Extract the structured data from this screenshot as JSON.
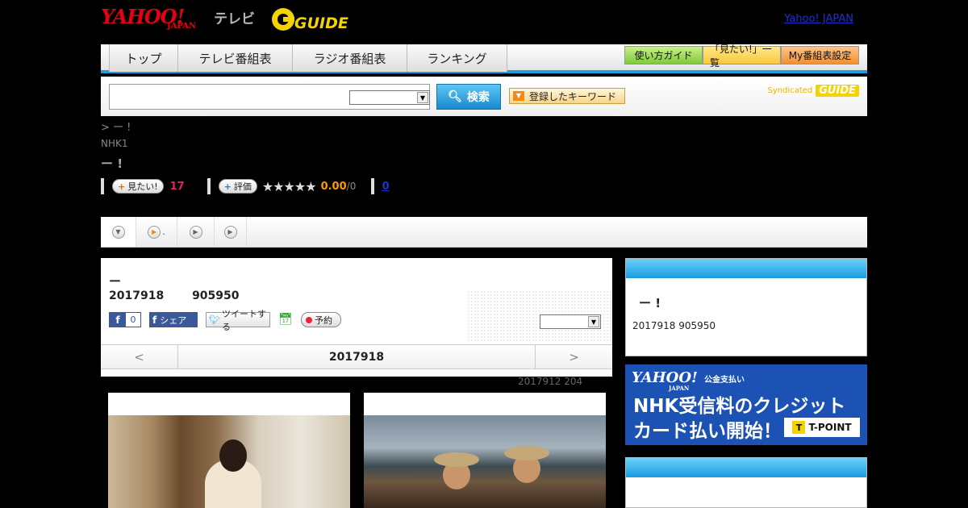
{
  "header": {
    "yahoo_logo": "YAHOO!",
    "yahoo_sub": "JAPAN",
    "tv_label": "テレビ",
    "gguide_logo": "GUIDE",
    "yahoo_japan_link": "Yahoo! JAPAN"
  },
  "nav": {
    "tabs": [
      "トップ",
      "テレビ番組表",
      "ラジオ番組表",
      "ランキング"
    ],
    "right_buttons": [
      "使い方ガイド",
      "「見たい!」一覧",
      "My番組表設定"
    ]
  },
  "search": {
    "input_value": "",
    "select_value": "",
    "button_label": "検索",
    "keyword_button": "登録したキーワード",
    "syndicated": "Syndicated",
    "syndicated_logo": "GUIDE"
  },
  "program": {
    "breadcrumb": "> ー !",
    "channel": "NHK1",
    "title": "ー !",
    "want_label": "見たい!",
    "want_count": "17",
    "rate_label": "評価",
    "stars": "★★★★★",
    "rating": "0.00",
    "rating_max": "/0",
    "review_count": "0"
  },
  "subtabs": [
    ".",
    "",
    ""
  ],
  "card": {
    "title": "ー",
    "datetime": "2017918 905950",
    "fb_count": "0",
    "fb_share": "シェア",
    "tweet": "ツイートする",
    "reserve": "予約",
    "select_value": "",
    "date_prev": "<",
    "date_current": "2017918",
    "date_next": ">"
  },
  "updated": "2017912  204",
  "sidebar": {
    "title": "ー !",
    "datetime": "2017918  905950"
  },
  "banner": {
    "yahoo": "YAHOO!",
    "japan": "JAPAN",
    "kokin": "公金支払い",
    "line1": "NHK受信料のクレジット",
    "line2": "カード払い開始！",
    "tpoint": "T-POINT",
    "t_icon": "T"
  },
  "colors": {
    "accent_blue": "#1d9ce0",
    "yahoo_red": "#e60012",
    "want_pink": "#e0206a",
    "rating_orange": "#ff9a00",
    "banner_blue": "#1b52b4"
  },
  "icons": [
    "search-icon",
    "play-icon",
    "chevron-down-icon",
    "calendar-icon",
    "facebook-icon",
    "twitter-icon"
  ]
}
